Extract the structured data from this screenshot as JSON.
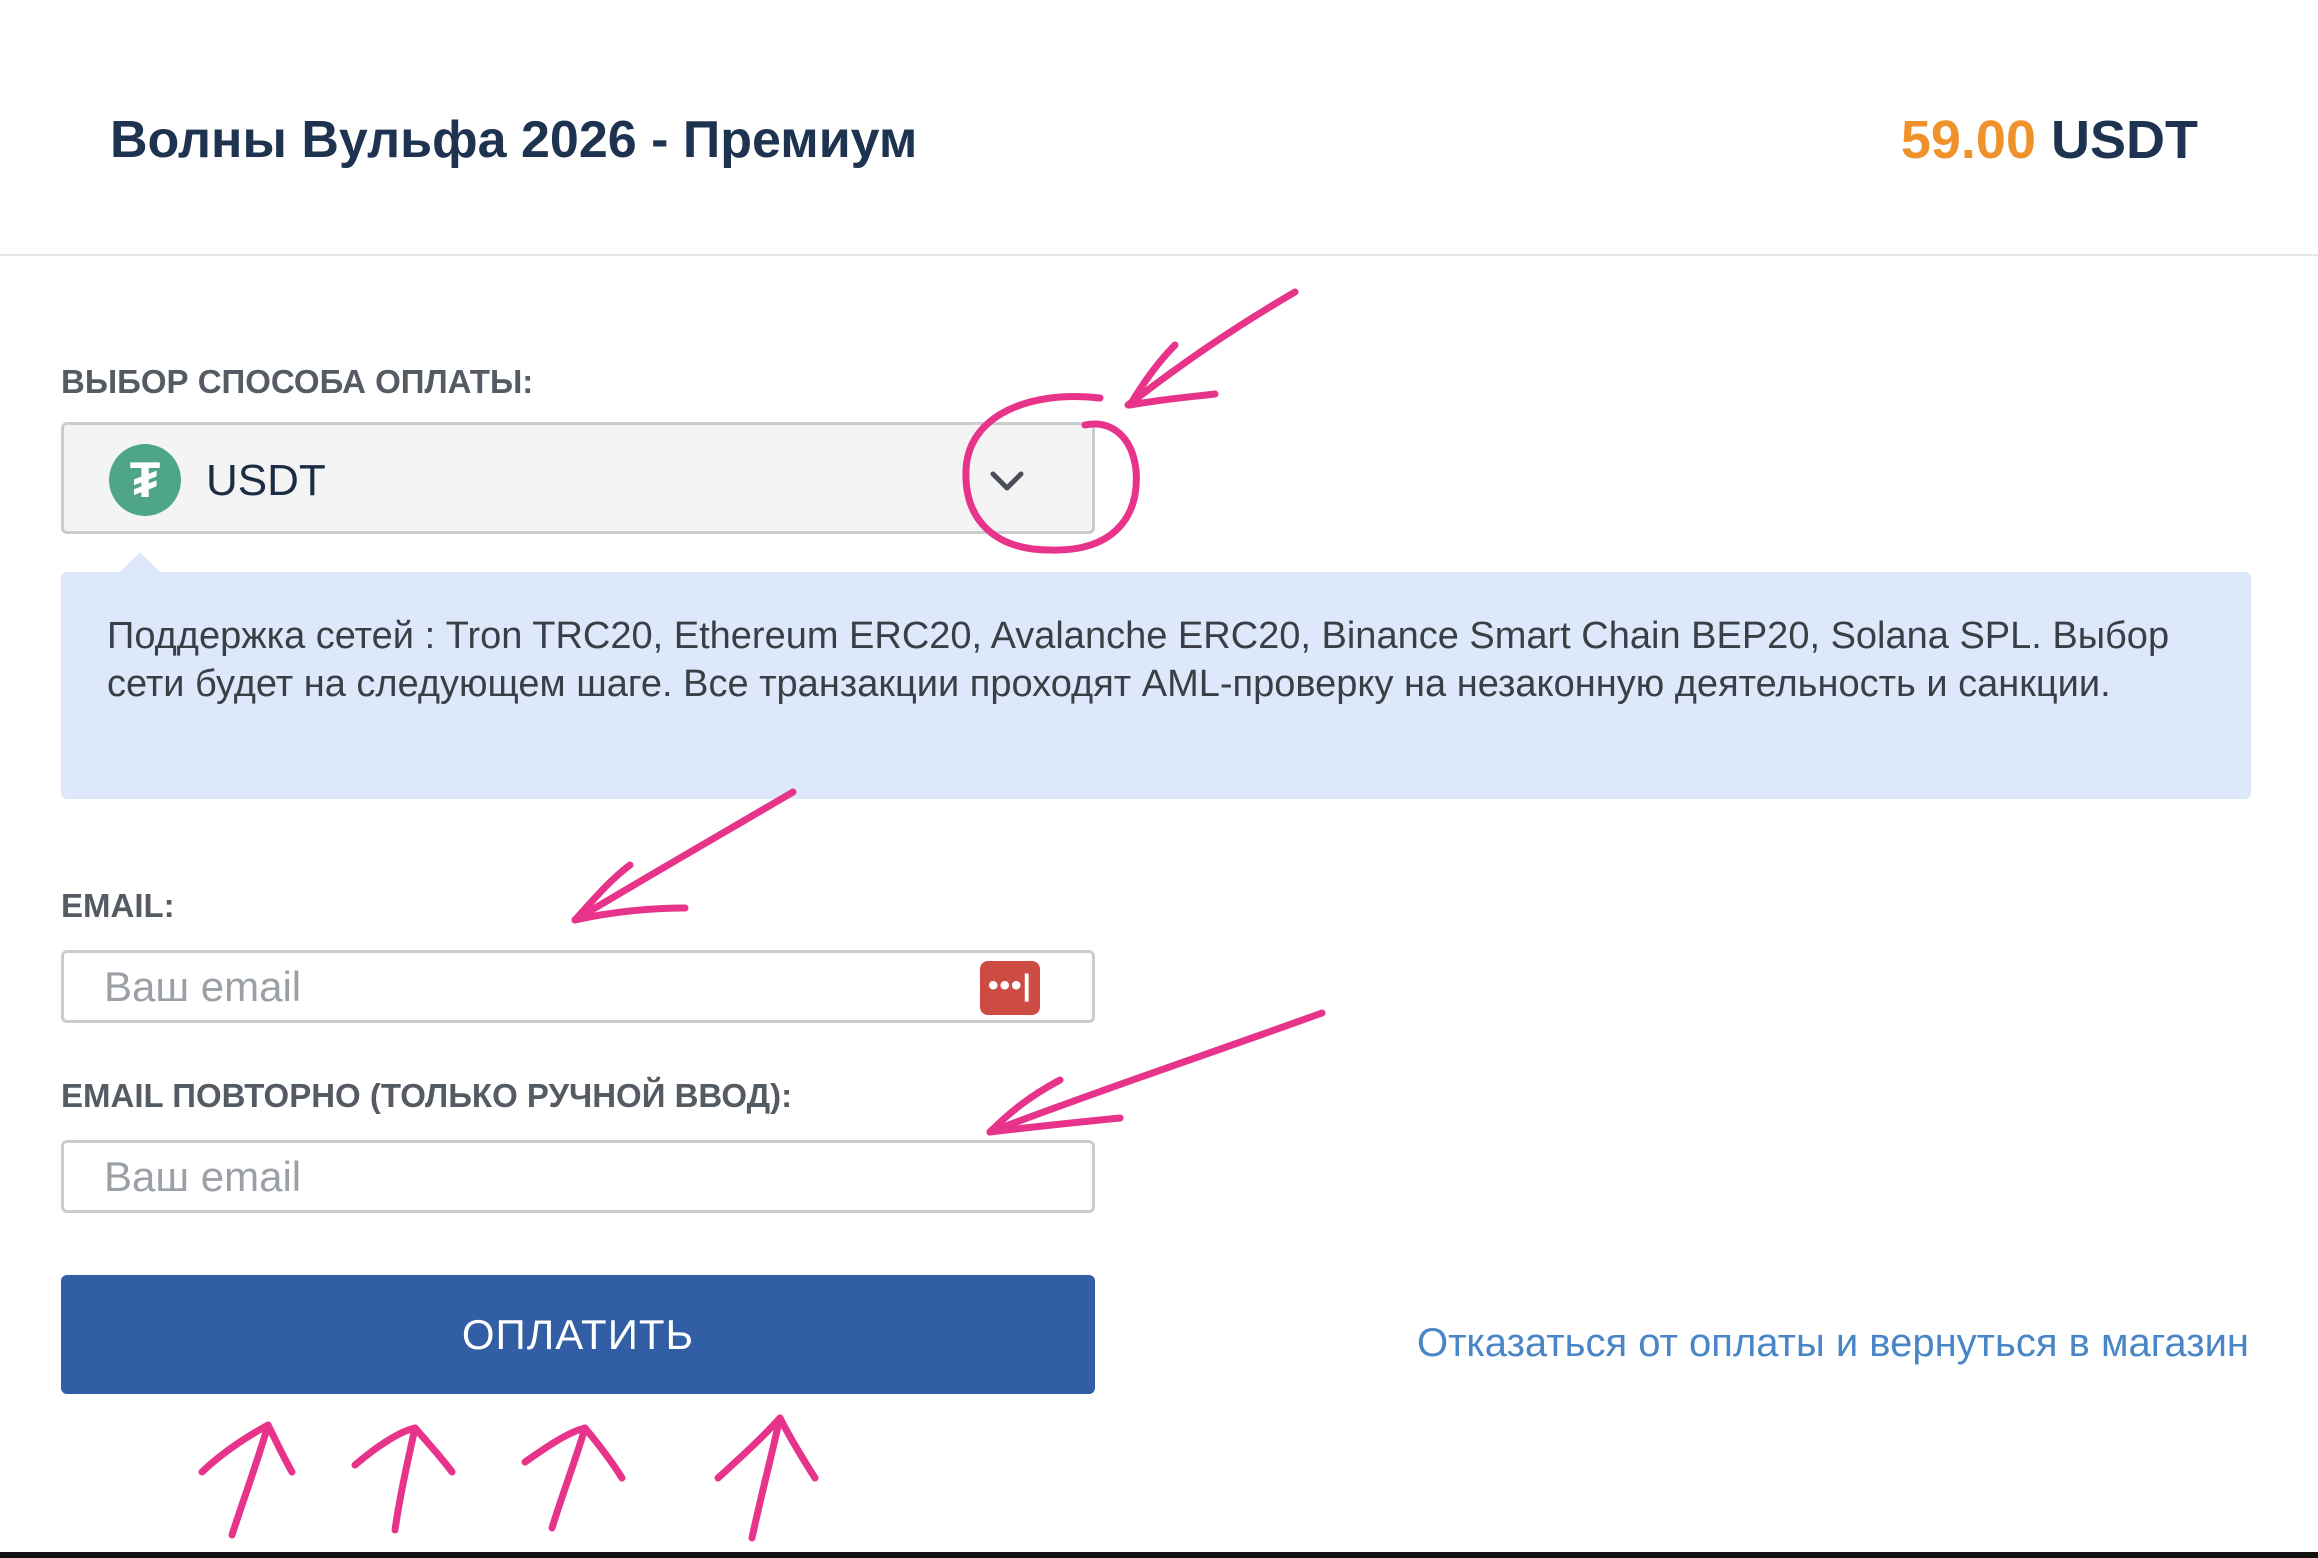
{
  "product": {
    "title": "Волны Вульфа 2026 - Премиум",
    "price_amount": "59.00",
    "price_currency": "USDT"
  },
  "payment": {
    "label": "ВЫБОР СПОСОБА ОПЛАТЫ:",
    "selected_method": "USDT",
    "method_icon": "tether-icon",
    "info_text": "Поддержка сетей : Tron TRC20, Ethereum ERC20, Avalanche ERC20, Binance Smart Chain BEP20, Solana SPL. Выбор сети будет на следующем шаге. Все транзакции проходят AML-проверку на незаконную деятельность и санкции."
  },
  "email": {
    "label": "EMAIL:",
    "placeholder": "Ваш email",
    "value": ""
  },
  "email_repeat": {
    "label": "EMAIL ПОВТОРНО (ТОЛЬКО РУЧНОЙ ВВОД):",
    "placeholder": "Ваш email",
    "value": ""
  },
  "actions": {
    "pay_label": "ОПЛАТИТЬ",
    "cancel_label": "Отказаться от оплаты и вернуться в магазин"
  },
  "colors": {
    "title": "#1d3350",
    "price_accent": "#f0922c",
    "pay_button": "#315ea4",
    "link": "#4a86c7",
    "info_background": "#dde9fb",
    "annotation": "#e8338a",
    "tether": "#4fa58a"
  },
  "icons": {
    "dropdown": "chevron-down-icon",
    "password_manager": "password-manager-icon"
  }
}
